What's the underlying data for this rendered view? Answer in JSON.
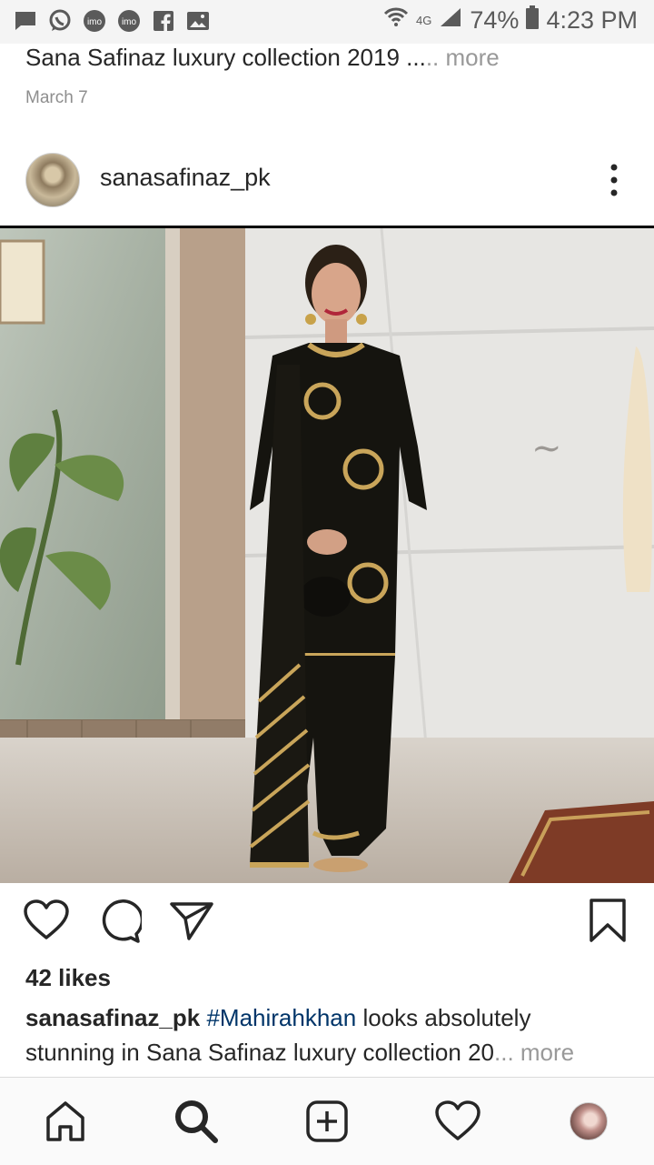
{
  "status_bar": {
    "battery": "74%",
    "time": "4:23 PM",
    "network": "4G",
    "icons": [
      "message-icon",
      "whatsapp-icon",
      "imo-icon",
      "imo-icon",
      "facebook-icon",
      "gallery-icon",
      "wifi-icon",
      "signal-icon",
      "battery-icon"
    ]
  },
  "previous_post": {
    "caption": "Sana Safinaz luxury collection 2019 ...",
    "more_label": ".. more",
    "date": "March 7"
  },
  "post": {
    "username": "sanasafinaz_pk",
    "likes": "42 likes",
    "caption_username": "sanasafinaz_pk",
    "hashtag": "#Mahirahkhan",
    "caption_text": " looks absolutely stunning in Sana Safinaz luxury collection 20",
    "caption_more": "... more"
  },
  "colors": {
    "status_bar_bg": "#f4f4f4",
    "hashtag": "#003569",
    "secondary_text": "#8e8e8e"
  },
  "nav": {
    "items": [
      "home-icon",
      "search-icon",
      "add-post-icon",
      "activity-heart-icon",
      "profile-avatar"
    ]
  }
}
